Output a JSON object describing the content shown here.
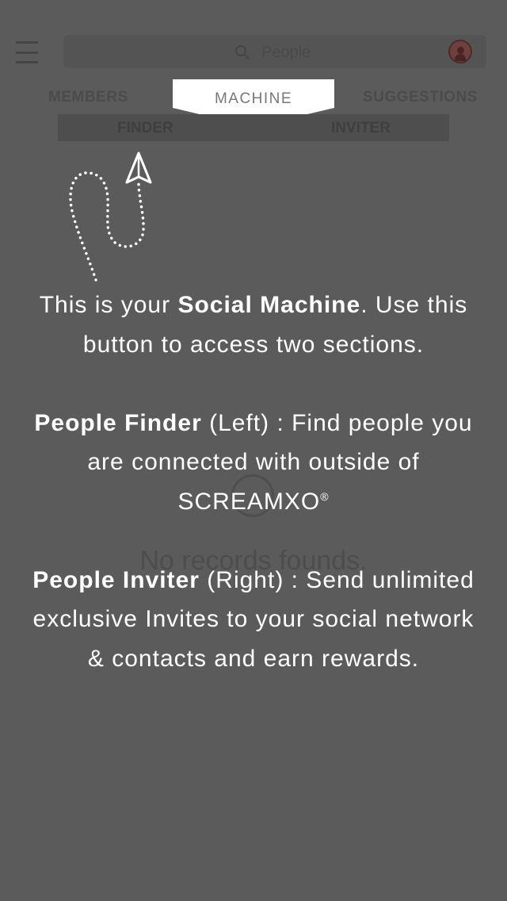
{
  "header": {
    "search_placeholder": "People",
    "menu_icon": "hamburger-icon",
    "search_icon": "search-icon",
    "avatar_icon": "user-avatar-icon"
  },
  "tabs": {
    "members": "MEMBERS",
    "machine": "MACHINE",
    "suggestions": "SUGGESTIONS"
  },
  "machine_subtabs": {
    "finder": "FINDER",
    "inviter": "INVITER"
  },
  "empty_state": {
    "text": "No records founds."
  },
  "tutorial": {
    "line1_prefix": "This is your ",
    "line1_bold": "Social Machine",
    "line1_suffix": ". Use this button to access two sections.",
    "finder_bold": "People Finder",
    "finder_text": " (Left) : Find people you are connected with outside of SCREAMXO",
    "finder_mark": "®",
    "inviter_bold": "People Inviter",
    "inviter_text": " (Right) : Send unlimited exclusive Invites to your social network & contacts and earn rewards."
  },
  "colors": {
    "overlay": "#5b5b5b",
    "text": "#ffffff"
  }
}
